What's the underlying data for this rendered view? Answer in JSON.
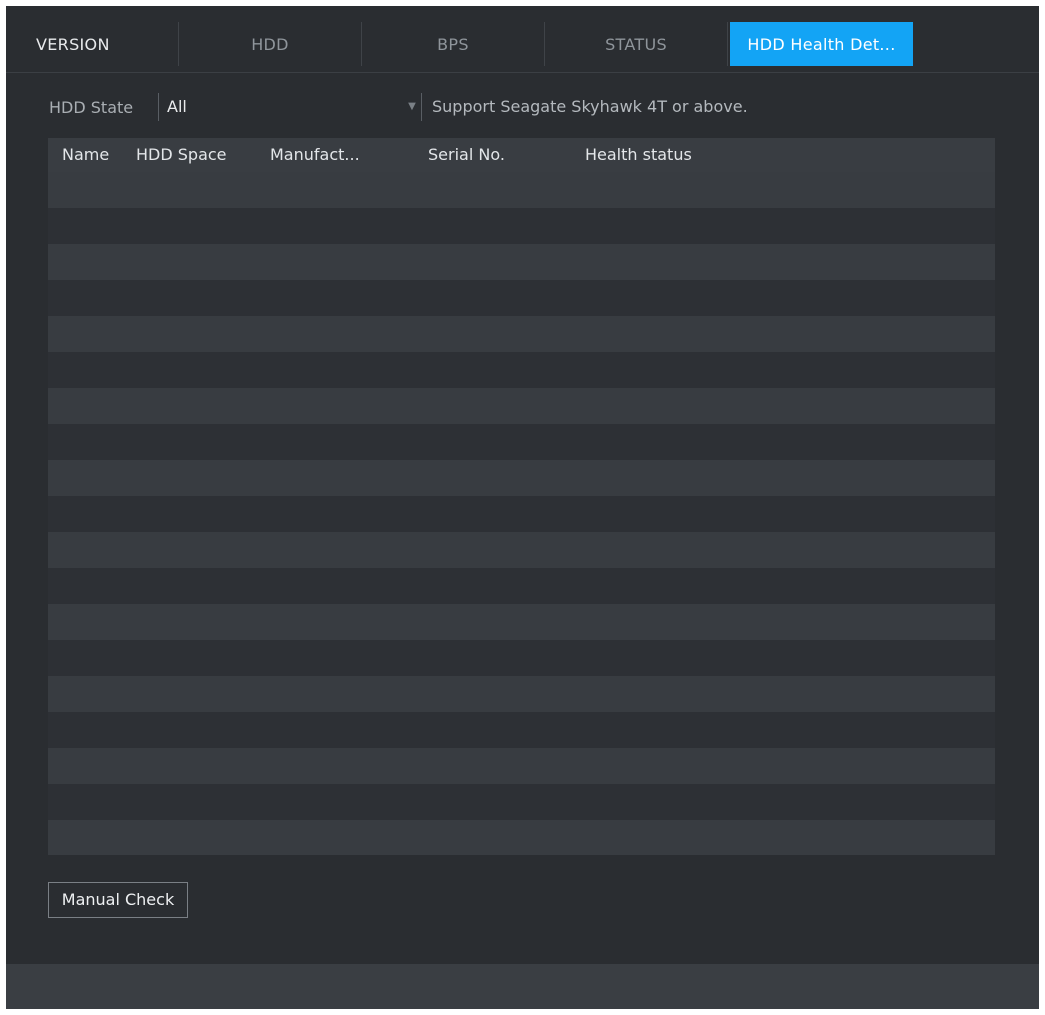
{
  "tabs": [
    {
      "label": "VERSION",
      "active": false
    },
    {
      "label": "HDD",
      "active": false
    },
    {
      "label": "BPS",
      "active": false
    },
    {
      "label": "STATUS",
      "active": false
    },
    {
      "label": "HDD Health Det...",
      "active": true
    }
  ],
  "filter": {
    "label": "HDD State",
    "selected": "All",
    "note": "Support Seagate Skyhawk 4T or above."
  },
  "table": {
    "columns": [
      "Name",
      "HDD Space",
      "Manufact...",
      "Serial No.",
      "Health status"
    ],
    "rows": []
  },
  "actions": {
    "manual_check": "Manual Check"
  },
  "colors": {
    "accent": "#13a4f5",
    "background": "#2a2d31"
  }
}
